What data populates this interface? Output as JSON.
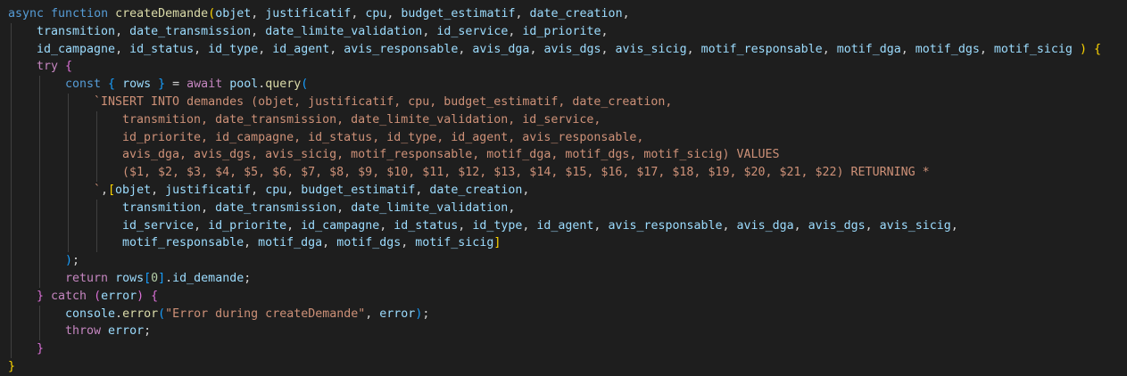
{
  "theme": {
    "background": "#1e1e1e",
    "default": "#d4d4d4",
    "keyword": "#569cd6",
    "control": "#c586c0",
    "function": "#dcdcaa",
    "variable": "#9cdcfe",
    "string": "#ce9178",
    "number": "#b5cea8",
    "bracket1": "#ffd700",
    "bracket2": "#da70d6",
    "bracket3": "#179fff"
  },
  "code": {
    "lines": [
      {
        "indent": 0,
        "tokens": [
          [
            "async",
            "keyword"
          ],
          [
            " ",
            "default"
          ],
          [
            "function",
            "keyword"
          ],
          [
            " ",
            "default"
          ],
          [
            "createDemande",
            "function"
          ],
          [
            "(",
            "bracket1"
          ],
          [
            "objet",
            "variable"
          ],
          [
            ", ",
            "default"
          ],
          [
            "justificatif",
            "variable"
          ],
          [
            ", ",
            "default"
          ],
          [
            "cpu",
            "variable"
          ],
          [
            ", ",
            "default"
          ],
          [
            "budget_estimatif",
            "variable"
          ],
          [
            ", ",
            "default"
          ],
          [
            "date_creation",
            "variable"
          ],
          [
            ",",
            "default"
          ]
        ]
      },
      {
        "indent": 1,
        "tokens": [
          [
            "transmition",
            "variable"
          ],
          [
            ", ",
            "default"
          ],
          [
            "date_transmission",
            "variable"
          ],
          [
            ", ",
            "default"
          ],
          [
            "date_limite_validation",
            "variable"
          ],
          [
            ", ",
            "default"
          ],
          [
            "id_service",
            "variable"
          ],
          [
            ", ",
            "default"
          ],
          [
            "id_priorite",
            "variable"
          ],
          [
            ",",
            "default"
          ]
        ]
      },
      {
        "indent": 1,
        "tokens": [
          [
            "id_campagne",
            "variable"
          ],
          [
            ", ",
            "default"
          ],
          [
            "id_status",
            "variable"
          ],
          [
            ", ",
            "default"
          ],
          [
            "id_type",
            "variable"
          ],
          [
            ", ",
            "default"
          ],
          [
            "id_agent",
            "variable"
          ],
          [
            ", ",
            "default"
          ],
          [
            "avis_responsable",
            "variable"
          ],
          [
            ", ",
            "default"
          ],
          [
            "avis_dga",
            "variable"
          ],
          [
            ", ",
            "default"
          ],
          [
            "avis_dgs",
            "variable"
          ],
          [
            ", ",
            "default"
          ],
          [
            "avis_sicig",
            "variable"
          ],
          [
            ", ",
            "default"
          ],
          [
            "motif_responsable",
            "variable"
          ],
          [
            ", ",
            "default"
          ],
          [
            "motif_dga",
            "variable"
          ],
          [
            ", ",
            "default"
          ],
          [
            "motif_dgs",
            "variable"
          ],
          [
            ", ",
            "default"
          ],
          [
            "motif_sicig",
            "variable"
          ],
          [
            " ",
            "default"
          ],
          [
            ")",
            "bracket1"
          ],
          [
            " ",
            "default"
          ],
          [
            "{",
            "bracket1"
          ]
        ]
      },
      {
        "indent": 1,
        "tokens": [
          [
            "try",
            "control"
          ],
          [
            " ",
            "default"
          ],
          [
            "{",
            "bracket2"
          ]
        ]
      },
      {
        "indent": 2,
        "tokens": [
          [
            "const",
            "keyword"
          ],
          [
            " ",
            "default"
          ],
          [
            "{",
            "bracket3"
          ],
          [
            " ",
            "default"
          ],
          [
            "rows",
            "variable"
          ],
          [
            " ",
            "default"
          ],
          [
            "}",
            "bracket3"
          ],
          [
            " = ",
            "default"
          ],
          [
            "await",
            "control"
          ],
          [
            " ",
            "default"
          ],
          [
            "pool",
            "variable"
          ],
          [
            ".",
            "default"
          ],
          [
            "query",
            "function"
          ],
          [
            "(",
            "bracket3"
          ]
        ]
      },
      {
        "indent": 3,
        "tokens": [
          [
            "`INSERT INTO demandes (objet, justificatif, cpu, budget_estimatif, date_creation,",
            "string"
          ]
        ]
      },
      {
        "indent": 4,
        "tokens": [
          [
            "transmition, date_transmission, date_limite_validation, id_service,",
            "string"
          ]
        ]
      },
      {
        "indent": 4,
        "tokens": [
          [
            "id_priorite, id_campagne, id_status, id_type, id_agent, avis_responsable,",
            "string"
          ]
        ]
      },
      {
        "indent": 4,
        "tokens": [
          [
            "avis_dga, avis_dgs, avis_sicig, motif_responsable, motif_dga, motif_dgs, motif_sicig) VALUES",
            "string"
          ]
        ]
      },
      {
        "indent": 4,
        "tokens": [
          [
            "($1, $2, $3, $4, $5, $6, $7, $8, $9, $10, $11, $12, $13, $14, $15, $16, $17, $18, $19, $20, $21, $22) RETURNING *",
            "string"
          ]
        ]
      },
      {
        "indent": 3,
        "tokens": [
          [
            "`",
            "string"
          ],
          [
            ",",
            "default"
          ],
          [
            "[",
            "bracket1"
          ],
          [
            "objet",
            "variable"
          ],
          [
            ", ",
            "default"
          ],
          [
            "justificatif",
            "variable"
          ],
          [
            ", ",
            "default"
          ],
          [
            "cpu",
            "variable"
          ],
          [
            ", ",
            "default"
          ],
          [
            "budget_estimatif",
            "variable"
          ],
          [
            ", ",
            "default"
          ],
          [
            "date_creation",
            "variable"
          ],
          [
            ",",
            "default"
          ]
        ]
      },
      {
        "indent": 4,
        "tokens": [
          [
            "transmition",
            "variable"
          ],
          [
            ", ",
            "default"
          ],
          [
            "date_transmission",
            "variable"
          ],
          [
            ", ",
            "default"
          ],
          [
            "date_limite_validation",
            "variable"
          ],
          [
            ",",
            "default"
          ]
        ]
      },
      {
        "indent": 4,
        "tokens": [
          [
            "id_service",
            "variable"
          ],
          [
            ", ",
            "default"
          ],
          [
            "id_priorite",
            "variable"
          ],
          [
            ", ",
            "default"
          ],
          [
            "id_campagne",
            "variable"
          ],
          [
            ", ",
            "default"
          ],
          [
            "id_status",
            "variable"
          ],
          [
            ", ",
            "default"
          ],
          [
            "id_type",
            "variable"
          ],
          [
            ", ",
            "default"
          ],
          [
            "id_agent",
            "variable"
          ],
          [
            ", ",
            "default"
          ],
          [
            "avis_responsable",
            "variable"
          ],
          [
            ", ",
            "default"
          ],
          [
            "avis_dga",
            "variable"
          ],
          [
            ", ",
            "default"
          ],
          [
            "avis_dgs",
            "variable"
          ],
          [
            ", ",
            "default"
          ],
          [
            "avis_sicig",
            "variable"
          ],
          [
            ",",
            "default"
          ]
        ]
      },
      {
        "indent": 4,
        "tokens": [
          [
            "motif_responsable",
            "variable"
          ],
          [
            ", ",
            "default"
          ],
          [
            "motif_dga",
            "variable"
          ],
          [
            ", ",
            "default"
          ],
          [
            "motif_dgs",
            "variable"
          ],
          [
            ", ",
            "default"
          ],
          [
            "motif_sicig",
            "variable"
          ],
          [
            "]",
            "bracket1"
          ]
        ]
      },
      {
        "indent": 2,
        "tokens": [
          [
            ")",
            "bracket3"
          ],
          [
            ";",
            "default"
          ]
        ]
      },
      {
        "indent": 2,
        "tokens": [
          [
            "return",
            "control"
          ],
          [
            " ",
            "default"
          ],
          [
            "rows",
            "variable"
          ],
          [
            "[",
            "bracket3"
          ],
          [
            "0",
            "number"
          ],
          [
            "]",
            "bracket3"
          ],
          [
            ".",
            "default"
          ],
          [
            "id_demande",
            "variable"
          ],
          [
            ";",
            "default"
          ]
        ]
      },
      {
        "indent": 1,
        "tokens": [
          [
            "}",
            "bracket2"
          ],
          [
            " ",
            "default"
          ],
          [
            "catch",
            "control"
          ],
          [
            " ",
            "default"
          ],
          [
            "(",
            "bracket2"
          ],
          [
            "error",
            "variable"
          ],
          [
            ")",
            "bracket2"
          ],
          [
            " ",
            "default"
          ],
          [
            "{",
            "bracket2"
          ]
        ]
      },
      {
        "indent": 2,
        "tokens": [
          [
            "console",
            "variable"
          ],
          [
            ".",
            "default"
          ],
          [
            "error",
            "function"
          ],
          [
            "(",
            "bracket3"
          ],
          [
            "\"Error during createDemande\"",
            "string"
          ],
          [
            ", ",
            "default"
          ],
          [
            "error",
            "variable"
          ],
          [
            ")",
            "bracket3"
          ],
          [
            ";",
            "default"
          ]
        ]
      },
      {
        "indent": 2,
        "tokens": [
          [
            "throw",
            "control"
          ],
          [
            " ",
            "default"
          ],
          [
            "error",
            "variable"
          ],
          [
            ";",
            "default"
          ]
        ]
      },
      {
        "indent": 1,
        "tokens": [
          [
            "}",
            "bracket2"
          ]
        ]
      },
      {
        "indent": 0,
        "tokens": [
          [
            "}",
            "bracket1"
          ]
        ]
      }
    ]
  }
}
